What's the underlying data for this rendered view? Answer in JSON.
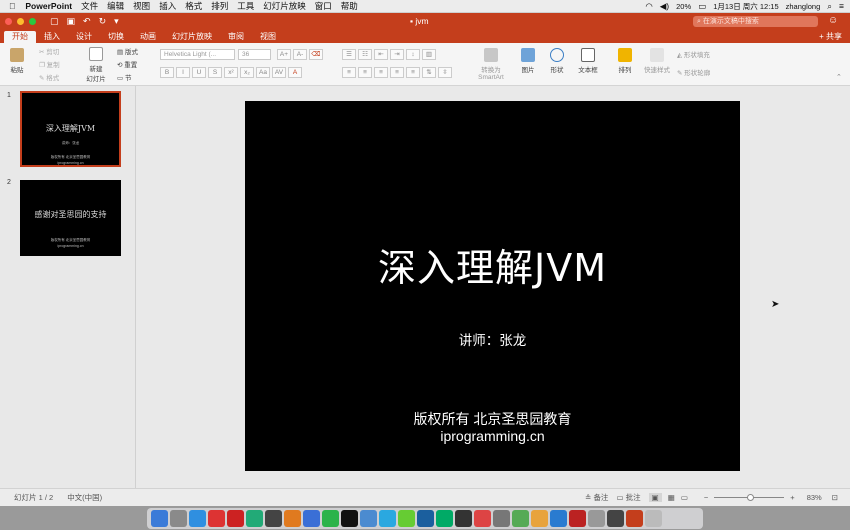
{
  "menubar": {
    "app_name": "PowerPoint",
    "items": [
      "文件",
      "编辑",
      "视图",
      "插入",
      "格式",
      "排列",
      "工具",
      "幻灯片放映",
      "窗口",
      "帮助"
    ],
    "battery": "20%",
    "clock": "1月13日 周六 12:15",
    "user": "zhanglong"
  },
  "window": {
    "title": "jvm",
    "search_placeholder": "在演示文稿中搜索"
  },
  "ribbon_tabs": [
    "开始",
    "插入",
    "设计",
    "切换",
    "动画",
    "幻灯片放映",
    "审阅",
    "视图"
  ],
  "active_tab": "开始",
  "share_label": "共享",
  "ribbon": {
    "paste": "粘贴",
    "cut": "剪切",
    "copy": "复制",
    "format_painter": "格式",
    "new_slide": "新建\n幻灯片",
    "layout": "版式",
    "reset": "重置",
    "section": "节",
    "font_name": "Helvetica Light (...",
    "font_size": "36",
    "convert_smartart": "转换为\nSmartArt",
    "picture": "图片",
    "shape": "形状",
    "textbox": "文本框",
    "arrange": "排列",
    "quick_styles": "快速样式",
    "shape_fill": "形状填充",
    "shape_outline": "形状轮廓"
  },
  "slides": [
    {
      "number": "1",
      "title": "深入理解JVM",
      "sub": "讲师：张龙",
      "footer": "版权所有 北京圣思园教育",
      "site": "iprogramming.cn"
    },
    {
      "number": "2",
      "title": "感谢对圣思园的支持",
      "footer": "版权所有 北京圣思园教育",
      "site": "iprogramming.cn"
    }
  ],
  "main_slide": {
    "title": "深入理解JVM",
    "subtitle": "讲师：张龙",
    "copyright": "版权所有  北京圣思园教育",
    "website": "iprogramming.cn"
  },
  "status": {
    "slide_info": "幻灯片 1 / 2",
    "language": "中文(中国)",
    "notes": "备注",
    "comments": "批注",
    "zoom": "83%"
  },
  "colors": {
    "accent": "#c43e1c"
  }
}
